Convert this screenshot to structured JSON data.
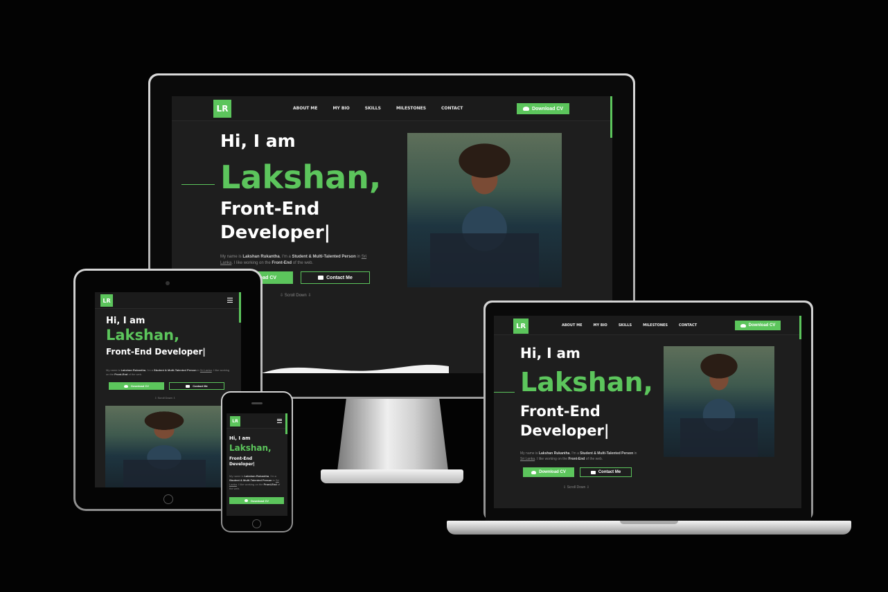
{
  "site": {
    "logo": "LR",
    "nav": [
      "About Me",
      "My Bio",
      "Skills",
      "Milestones",
      "Contact"
    ],
    "download_cv": "Download CV",
    "contact_me": "Contact Me",
    "hi": "Hi, I am",
    "name": "Lakshan,",
    "role_line1": "Front-End",
    "role_line2": "Developer|",
    "role_full": "Front-End Developer|",
    "bio_prefix": "My name is ",
    "bio_name": "Lakshan Rukantha",
    "bio_mid": ", I'm a ",
    "bio_strong": "Student & Multi-Talented Person",
    "bio_in": " in ",
    "bio_country": "Sri Lanka",
    "bio_rest": ". I like working on the ",
    "bio_front": "Front-End",
    "bio_end": " of the web.",
    "scroll_down": "⇩ Scroll Down ⇩",
    "menu_icon": "hamburger-menu-icon",
    "download_icon": "cloud-download-icon",
    "mail_icon": "mail-icon"
  },
  "colors": {
    "accent": "#5cc55c",
    "background": "#1e1e1e",
    "page": "#030303"
  }
}
